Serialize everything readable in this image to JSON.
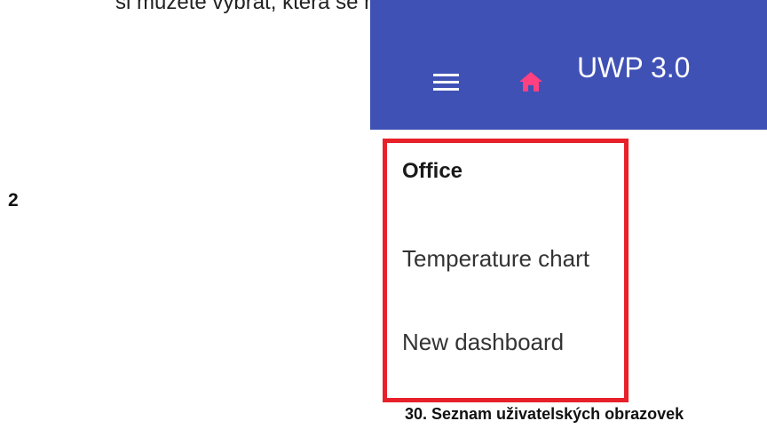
{
  "document": {
    "intro_text": "si můžete vybrat, která se má zobrazit.",
    "step_number": "2",
    "caption": "30.  Seznam uživatelských obrazovek"
  },
  "app": {
    "title": "UWP 3.0",
    "header_color": "#3f51b5",
    "home_icon_color": "#ff4081",
    "icons": [
      "hamburger-menu-icon",
      "home-icon"
    ]
  },
  "screen_list": {
    "highlight_color": "#e8202a",
    "items": [
      {
        "label": "Office",
        "active": true
      },
      {
        "label": "Temperature chart",
        "active": false
      },
      {
        "label": "New dashboard",
        "active": false
      }
    ]
  }
}
